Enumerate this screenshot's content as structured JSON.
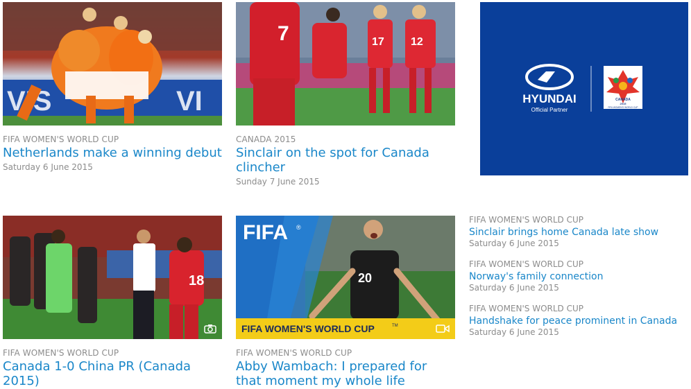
{
  "cards": [
    {
      "category": "FIFA WOMEN'S WORLD CUP",
      "title": "Netherlands make a winning debut",
      "date": "Saturday 6 June 2015",
      "image_desc": "netherlands-team-celebration-photo",
      "board_text": "VIS",
      "board_text_right": "VI"
    },
    {
      "category": "CANADA 2015",
      "title": "Sinclair on the spot for Canada clincher",
      "date": "Sunday 7 June 2015",
      "image_desc": "canada-players-celebration-photo",
      "jersey_numbers": [
        "7",
        "17",
        "12"
      ]
    },
    {
      "category": "FIFA WOMEN'S WORLD CUP",
      "title": "Canada 1-0 China PR (Canada 2015)",
      "date": "",
      "media_icon": "camera-icon",
      "jersey_numbers": [
        "18"
      ]
    },
    {
      "category": "FIFA WOMEN'S WORLD CUP",
      "title": "Abby Wambach: I prepared for that moment my whole life",
      "date": "",
      "media_icon": "video-icon",
      "brand": "FIFA",
      "banner": "FIFA WOMEN'S WORLD CUP",
      "jersey_numbers": [
        "20"
      ]
    }
  ],
  "ad": {
    "brand": "HYUNDAI",
    "tagline": "Official Partner",
    "event_top": "CANADA",
    "event_year": "2015",
    "event_name": "FIFA WOMEN'S WORLD CUP",
    "colors": {
      "background": "#0a3f9a"
    }
  },
  "side_list": [
    {
      "category": "FIFA WOMEN'S WORLD CUP",
      "title": "Sinclair brings home Canada late show",
      "date": "Saturday 6 June 2015"
    },
    {
      "category": "FIFA WOMEN'S WORLD CUP",
      "title": "Norway's family connection",
      "date": "Saturday 6 June 2015"
    },
    {
      "category": "FIFA WOMEN'S WORLD CUP",
      "title": "Handshake for peace prominent in Canada",
      "date": "Saturday 6 June 2015"
    }
  ],
  "colors": {
    "link": "#1a87c9",
    "meta": "#8c8c8c"
  }
}
